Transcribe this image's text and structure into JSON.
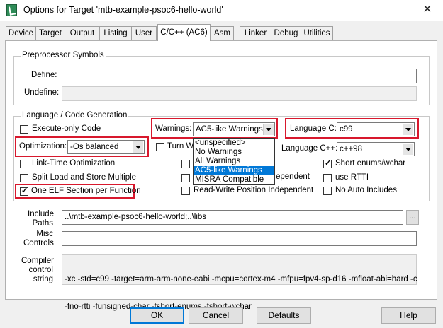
{
  "window": {
    "title": "Options for Target 'mtb-example-psoc6-hello-world'",
    "close_glyph": "✕"
  },
  "tabs": [
    {
      "label": "Device"
    },
    {
      "label": "Target"
    },
    {
      "label": "Output"
    },
    {
      "label": "Listing"
    },
    {
      "label": "User"
    },
    {
      "label": "C/C++ (AC6)"
    },
    {
      "label": "Asm"
    },
    {
      "label": "Linker"
    },
    {
      "label": "Debug"
    },
    {
      "label": "Utilities"
    }
  ],
  "active_tab": "C/C++ (AC6)",
  "preprocessor": {
    "group_label": "Preprocessor Symbols",
    "define_label": "Define:",
    "define_value": "",
    "undefine_label": "Undefine:",
    "undefine_value": ""
  },
  "language": {
    "group_label": "Language / Code Generation",
    "execute_only": {
      "label": "Execute-only Code",
      "checked": false
    },
    "optimization_label": "Optimization:",
    "optimization_value": "-Os balanced",
    "warnings_label": "Warnings:",
    "warnings_value": "AC5-like Warnings",
    "warnings_options": [
      "<unspecified>",
      "No Warnings",
      "All Warnings",
      "AC5-like Warnings",
      "MISRA Compatible"
    ],
    "warnings_selected": "AC5-like Warnings",
    "turn_warnings": {
      "label": "Turn Wa",
      "checked": false
    },
    "lang_c_label": "Language C:",
    "lang_c_value": "c99",
    "lang_cpp_label": "Language C++:",
    "lang_cpp_value": "c++98",
    "link_time": {
      "label": "Link-Time Optimization",
      "checked": false
    },
    "split_load": {
      "label": "Split Load and Store Multiple",
      "checked": false
    },
    "one_elf": {
      "label": "One ELF Section per Function",
      "checked": true
    },
    "ro_pi_tail": {
      "label": "ependent",
      "checked": false
    },
    "rw_pi": {
      "label": "Read-Write Position Independent",
      "checked": false
    },
    "short_enums": {
      "label": "Short enums/wchar",
      "checked": true
    },
    "use_rtti": {
      "label": "use RTTI",
      "checked": false
    },
    "no_auto_includes": {
      "label": "No Auto Includes",
      "checked": false
    }
  },
  "include_paths": {
    "label_line1": "Include",
    "label_line2": "Paths",
    "value": "..\\mtb-example-psoc6-hello-world;..\\libs",
    "browse_label": "..."
  },
  "misc_controls": {
    "label_line1": "Misc",
    "label_line2": "Controls",
    "value": ""
  },
  "compiler_control": {
    "label_line1": "Compiler",
    "label_line2": "control",
    "label_line3": "string",
    "line1": "-xc -std=c99 -target=arm-arm-none-eabi -mcpu=cortex-m4 -mfpu=fpv4-sp-d16 -mfloat-abi=hard -c",
    "line2": "-fno-rtti -funsigned-char -fshort-enums -fshort-wchar"
  },
  "buttons": {
    "ok": "OK",
    "cancel": "Cancel",
    "defaults": "Defaults",
    "help": "Help"
  },
  "colors": {
    "highlight": "#d8182d",
    "selection": "#0078d7"
  }
}
